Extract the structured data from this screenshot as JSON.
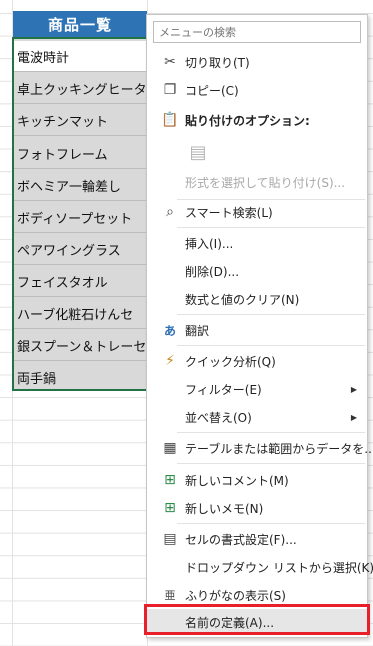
{
  "sheet": {
    "header": "商品一覧",
    "rows": [
      "電波時計",
      "卓上クッキングヒータ",
      "キッチンマット",
      "フォトフレーム",
      "ボヘミア一輪差し",
      "ボディソープセット",
      "ペアワイングラス",
      "フェイスタオル",
      "ハーブ化粧石けんセ",
      "銀スプーン＆トレーセ",
      "両手鍋"
    ]
  },
  "menu": {
    "search_placeholder": "メニューの検索",
    "cut": "切り取り(T)",
    "copy": "コピー(C)",
    "paste_options": "貼り付けのオプション:",
    "paste_special": "形式を選択して貼り付け(S)...",
    "smart_lookup": "スマート検索(L)",
    "insert": "挿入(I)...",
    "delete": "削除(D)...",
    "clear_contents": "数式と値のクリア(N)",
    "translate": "翻訳",
    "quick_analysis": "クイック分析(Q)",
    "filter": "フィルター(E)",
    "sort": "並べ替え(O)",
    "get_data": "テーブルまたは範囲からデータを...",
    "new_comment": "新しいコメント(M)",
    "new_note": "新しいメモ(N)",
    "format_cells": "セルの書式設定(F)...",
    "pick_dropdown": "ドロップダウン リストから選択(K)...",
    "phonetic": "ふりがなの表示(S)",
    "define_name": "名前の定義(A)..."
  },
  "icons": {
    "cut": "scissors-icon",
    "copy": "copy-icon",
    "paste": "clipboard-icon",
    "search": "magnifier-icon",
    "translate": "translate-icon",
    "quick_analysis": "quick-analysis-icon",
    "get_data": "table-icon",
    "comment": "comment-icon",
    "note": "note-icon",
    "format_cells": "format-cells-icon",
    "phonetic": "phonetic-icon"
  },
  "colors": {
    "header_fill": "#2e74b5",
    "selection_border": "#217346",
    "highlight_border": "#e8202a"
  }
}
